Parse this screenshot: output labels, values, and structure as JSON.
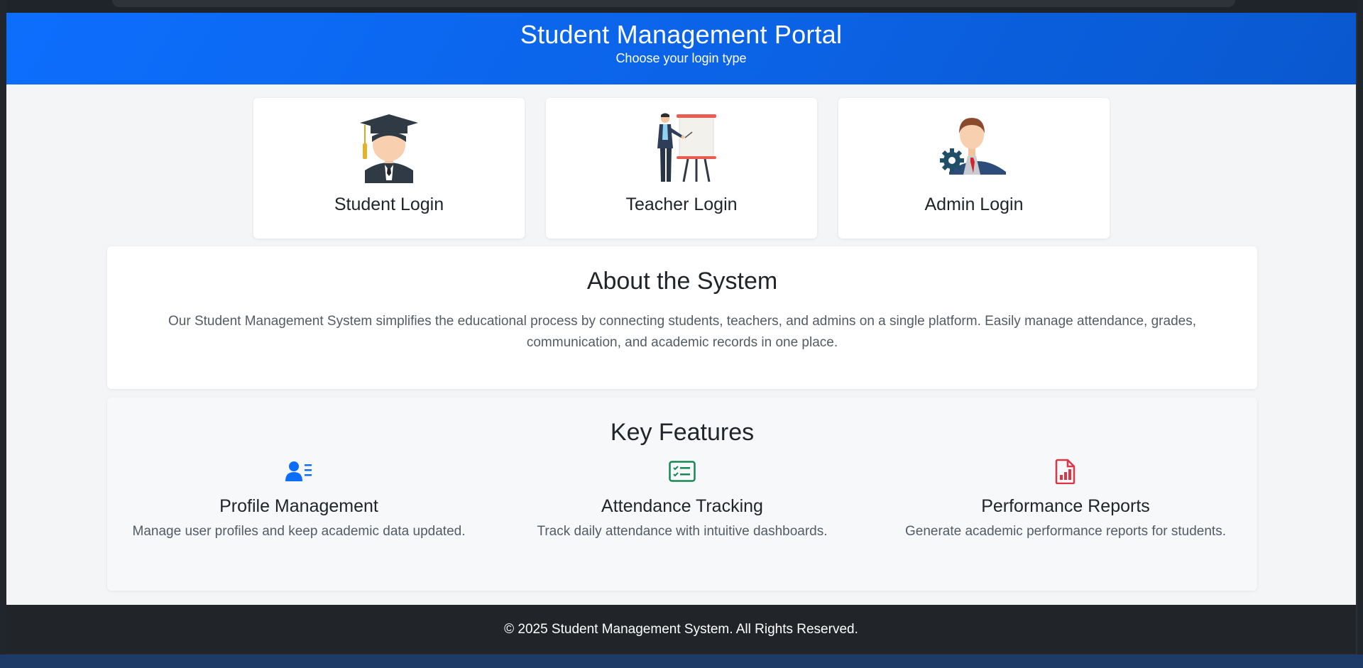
{
  "header": {
    "title": "Student Management Portal",
    "subtitle": "Choose your login type",
    "color": "#0d6efd"
  },
  "logins": [
    {
      "label": "Student Login",
      "icon": "graduate-icon"
    },
    {
      "label": "Teacher Login",
      "icon": "teacher-presentation-icon"
    },
    {
      "label": "Admin Login",
      "icon": "admin-gear-icon"
    }
  ],
  "about": {
    "title": "About the System",
    "text": "Our Student Management System simplifies the educational process by connecting students, teachers, and admins on a single platform. Easily manage attendance, grades, communication, and academic records in one place."
  },
  "features": {
    "title": "Key Features",
    "items": [
      {
        "title": "Profile Management",
        "text": "Manage user profiles and keep academic data updated.",
        "icon": "user-list-icon",
        "color": "#0d6efd"
      },
      {
        "title": "Attendance Tracking",
        "text": "Track daily attendance with intuitive dashboards.",
        "icon": "checklist-card-icon",
        "color": "#198754"
      },
      {
        "title": "Performance Reports",
        "text": "Generate academic performance reports for students.",
        "icon": "report-chart-icon",
        "color": "#dc3545"
      }
    ]
  },
  "footer": {
    "text": "© 2025 Student Management System. All Rights Reserved."
  }
}
